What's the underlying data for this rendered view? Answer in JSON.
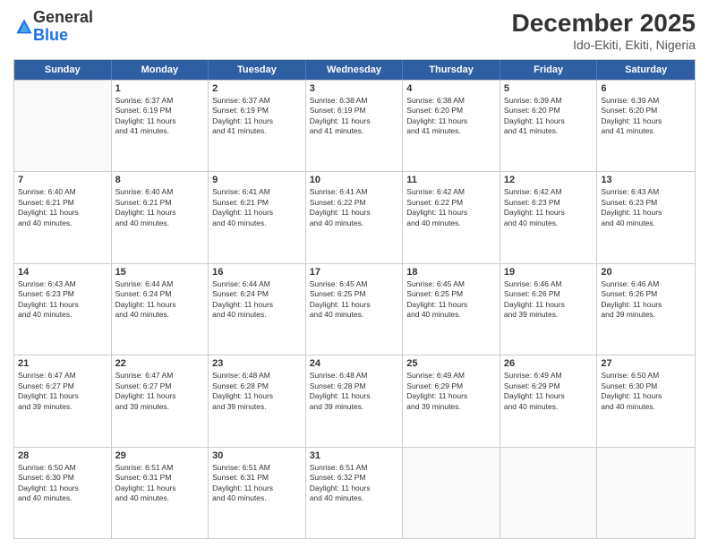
{
  "logo": {
    "general": "General",
    "blue": "Blue"
  },
  "header": {
    "month": "December 2025",
    "location": "Ido-Ekiti, Ekiti, Nigeria"
  },
  "days": [
    "Sunday",
    "Monday",
    "Tuesday",
    "Wednesday",
    "Thursday",
    "Friday",
    "Saturday"
  ],
  "rows": [
    [
      {
        "day": "",
        "empty": true
      },
      {
        "day": "1",
        "line1": "Sunrise: 6:37 AM",
        "line2": "Sunset: 6:19 PM",
        "line3": "Daylight: 11 hours",
        "line4": "and 41 minutes."
      },
      {
        "day": "2",
        "line1": "Sunrise: 6:37 AM",
        "line2": "Sunset: 6:19 PM",
        "line3": "Daylight: 11 hours",
        "line4": "and 41 minutes."
      },
      {
        "day": "3",
        "line1": "Sunrise: 6:38 AM",
        "line2": "Sunset: 6:19 PM",
        "line3": "Daylight: 11 hours",
        "line4": "and 41 minutes."
      },
      {
        "day": "4",
        "line1": "Sunrise: 6:38 AM",
        "line2": "Sunset: 6:20 PM",
        "line3": "Daylight: 11 hours",
        "line4": "and 41 minutes."
      },
      {
        "day": "5",
        "line1": "Sunrise: 6:39 AM",
        "line2": "Sunset: 6:20 PM",
        "line3": "Daylight: 11 hours",
        "line4": "and 41 minutes."
      },
      {
        "day": "6",
        "line1": "Sunrise: 6:39 AM",
        "line2": "Sunset: 6:20 PM",
        "line3": "Daylight: 11 hours",
        "line4": "and 41 minutes."
      }
    ],
    [
      {
        "day": "7",
        "line1": "Sunrise: 6:40 AM",
        "line2": "Sunset: 6:21 PM",
        "line3": "Daylight: 11 hours",
        "line4": "and 40 minutes."
      },
      {
        "day": "8",
        "line1": "Sunrise: 6:40 AM",
        "line2": "Sunset: 6:21 PM",
        "line3": "Daylight: 11 hours",
        "line4": "and 40 minutes."
      },
      {
        "day": "9",
        "line1": "Sunrise: 6:41 AM",
        "line2": "Sunset: 6:21 PM",
        "line3": "Daylight: 11 hours",
        "line4": "and 40 minutes."
      },
      {
        "day": "10",
        "line1": "Sunrise: 6:41 AM",
        "line2": "Sunset: 6:22 PM",
        "line3": "Daylight: 11 hours",
        "line4": "and 40 minutes."
      },
      {
        "day": "11",
        "line1": "Sunrise: 6:42 AM",
        "line2": "Sunset: 6:22 PM",
        "line3": "Daylight: 11 hours",
        "line4": "and 40 minutes."
      },
      {
        "day": "12",
        "line1": "Sunrise: 6:42 AM",
        "line2": "Sunset: 6:23 PM",
        "line3": "Daylight: 11 hours",
        "line4": "and 40 minutes."
      },
      {
        "day": "13",
        "line1": "Sunrise: 6:43 AM",
        "line2": "Sunset: 6:23 PM",
        "line3": "Daylight: 11 hours",
        "line4": "and 40 minutes."
      }
    ],
    [
      {
        "day": "14",
        "line1": "Sunrise: 6:43 AM",
        "line2": "Sunset: 6:23 PM",
        "line3": "Daylight: 11 hours",
        "line4": "and 40 minutes."
      },
      {
        "day": "15",
        "line1": "Sunrise: 6:44 AM",
        "line2": "Sunset: 6:24 PM",
        "line3": "Daylight: 11 hours",
        "line4": "and 40 minutes."
      },
      {
        "day": "16",
        "line1": "Sunrise: 6:44 AM",
        "line2": "Sunset: 6:24 PM",
        "line3": "Daylight: 11 hours",
        "line4": "and 40 minutes."
      },
      {
        "day": "17",
        "line1": "Sunrise: 6:45 AM",
        "line2": "Sunset: 6:25 PM",
        "line3": "Daylight: 11 hours",
        "line4": "and 40 minutes."
      },
      {
        "day": "18",
        "line1": "Sunrise: 6:45 AM",
        "line2": "Sunset: 6:25 PM",
        "line3": "Daylight: 11 hours",
        "line4": "and 40 minutes."
      },
      {
        "day": "19",
        "line1": "Sunrise: 6:46 AM",
        "line2": "Sunset: 6:26 PM",
        "line3": "Daylight: 11 hours",
        "line4": "and 39 minutes."
      },
      {
        "day": "20",
        "line1": "Sunrise: 6:46 AM",
        "line2": "Sunset: 6:26 PM",
        "line3": "Daylight: 11 hours",
        "line4": "and 39 minutes."
      }
    ],
    [
      {
        "day": "21",
        "line1": "Sunrise: 6:47 AM",
        "line2": "Sunset: 6:27 PM",
        "line3": "Daylight: 11 hours",
        "line4": "and 39 minutes."
      },
      {
        "day": "22",
        "line1": "Sunrise: 6:47 AM",
        "line2": "Sunset: 6:27 PM",
        "line3": "Daylight: 11 hours",
        "line4": "and 39 minutes."
      },
      {
        "day": "23",
        "line1": "Sunrise: 6:48 AM",
        "line2": "Sunset: 6:28 PM",
        "line3": "Daylight: 11 hours",
        "line4": "and 39 minutes."
      },
      {
        "day": "24",
        "line1": "Sunrise: 6:48 AM",
        "line2": "Sunset: 6:28 PM",
        "line3": "Daylight: 11 hours",
        "line4": "and 39 minutes."
      },
      {
        "day": "25",
        "line1": "Sunrise: 6:49 AM",
        "line2": "Sunset: 6:29 PM",
        "line3": "Daylight: 11 hours",
        "line4": "and 39 minutes."
      },
      {
        "day": "26",
        "line1": "Sunrise: 6:49 AM",
        "line2": "Sunset: 6:29 PM",
        "line3": "Daylight: 11 hours",
        "line4": "and 40 minutes."
      },
      {
        "day": "27",
        "line1": "Sunrise: 6:50 AM",
        "line2": "Sunset: 6:30 PM",
        "line3": "Daylight: 11 hours",
        "line4": "and 40 minutes."
      }
    ],
    [
      {
        "day": "28",
        "line1": "Sunrise: 6:50 AM",
        "line2": "Sunset: 6:30 PM",
        "line3": "Daylight: 11 hours",
        "line4": "and 40 minutes."
      },
      {
        "day": "29",
        "line1": "Sunrise: 6:51 AM",
        "line2": "Sunset: 6:31 PM",
        "line3": "Daylight: 11 hours",
        "line4": "and 40 minutes."
      },
      {
        "day": "30",
        "line1": "Sunrise: 6:51 AM",
        "line2": "Sunset: 6:31 PM",
        "line3": "Daylight: 11 hours",
        "line4": "and 40 minutes."
      },
      {
        "day": "31",
        "line1": "Sunrise: 6:51 AM",
        "line2": "Sunset: 6:32 PM",
        "line3": "Daylight: 11 hours",
        "line4": "and 40 minutes."
      },
      {
        "day": "",
        "empty": true
      },
      {
        "day": "",
        "empty": true
      },
      {
        "day": "",
        "empty": true
      }
    ]
  ]
}
